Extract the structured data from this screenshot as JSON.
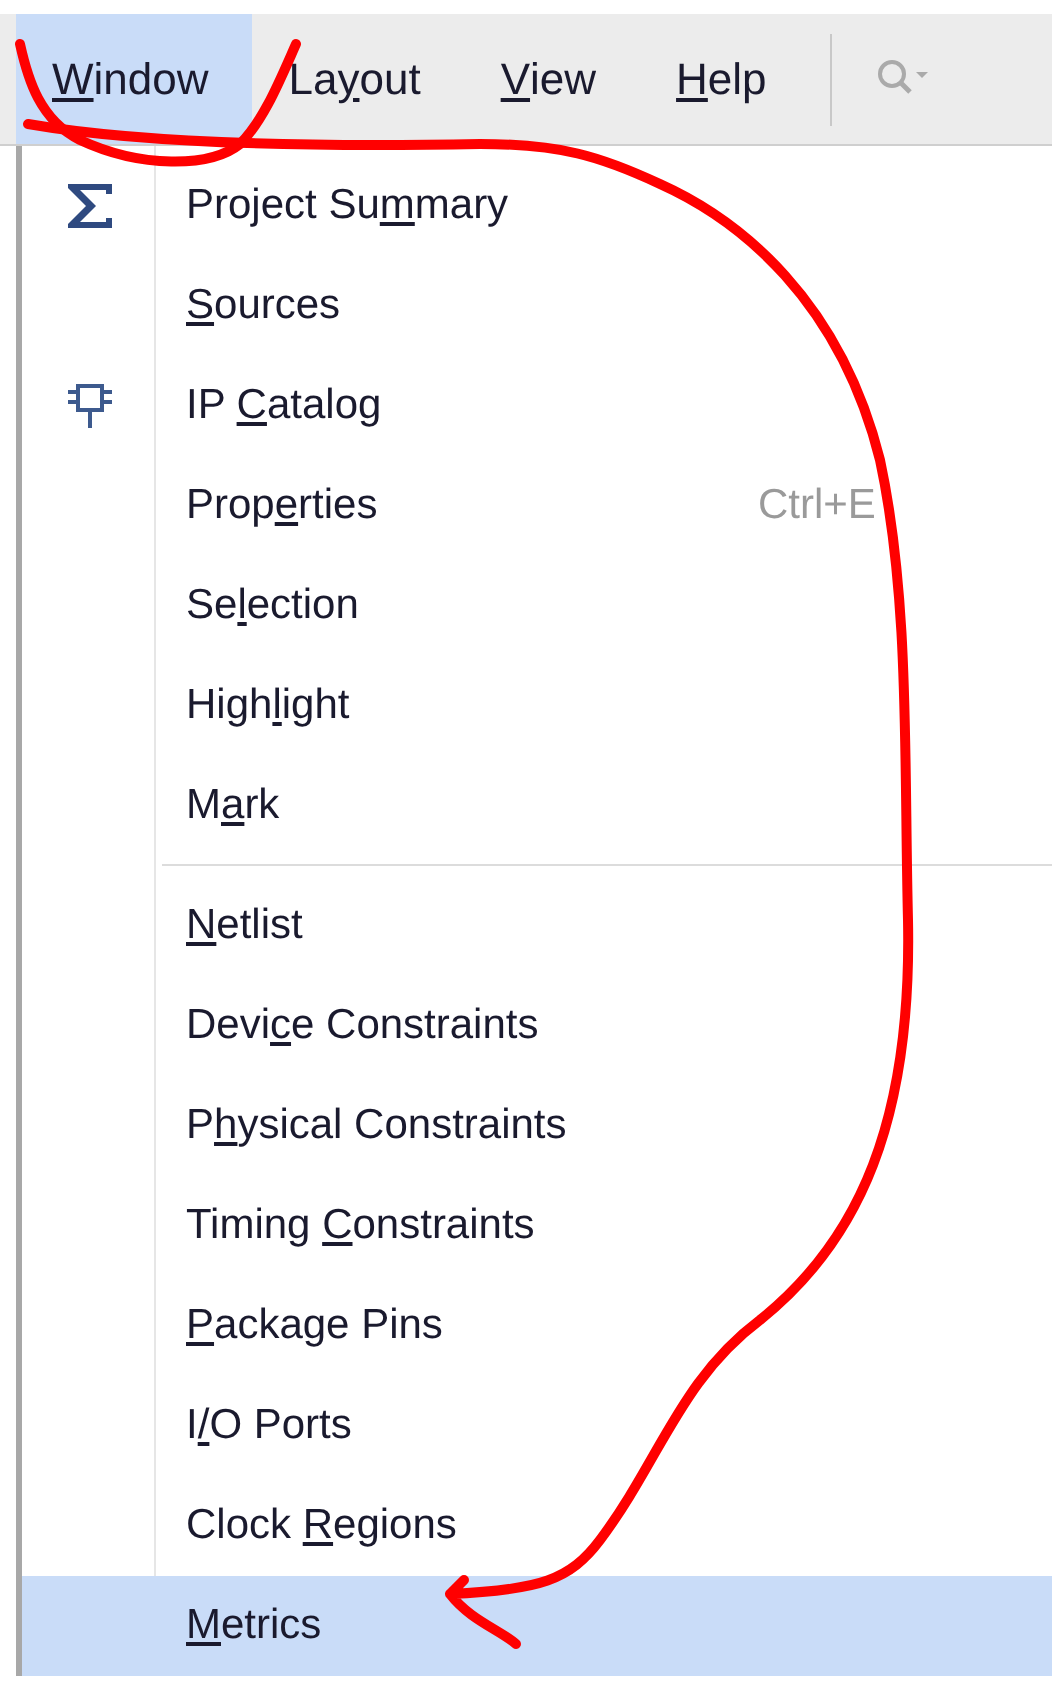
{
  "menubar": [
    {
      "mnemonic": "W",
      "rest": "indow",
      "selected": true
    },
    {
      "lead": "La",
      "mnemonic": "y",
      "rest": "out",
      "selected": false
    },
    {
      "mnemonic": "V",
      "rest": "iew",
      "selected": false
    },
    {
      "mnemonic": "H",
      "rest": "elp",
      "selected": false
    }
  ],
  "menu": {
    "groups": [
      [
        {
          "kind": "sum",
          "lead": "Project Su",
          "mnemonic": "m",
          "rest": "mary",
          "selected": false
        },
        {
          "mnemonic": "S",
          "rest": "ources",
          "selected": false
        },
        {
          "kind": "chip",
          "lead": "IP ",
          "mnemonic": "C",
          "rest": "atalog",
          "selected": false
        },
        {
          "lead": "Prop",
          "mnemonic": "e",
          "rest": "rties",
          "shortcut": "Ctrl+E",
          "selected": false
        },
        {
          "lead": "Se",
          "mnemonic": "l",
          "rest": "ection",
          "selected": false
        },
        {
          "lead": "High",
          "mnemonic": "l",
          "rest": "ight",
          "selected": false
        },
        {
          "lead": "M",
          "mnemonic": "a",
          "rest": "rk",
          "selected": false
        }
      ],
      [
        {
          "mnemonic": "N",
          "rest": "etlist",
          "selected": false
        },
        {
          "lead": "Devi",
          "mnemonic": "c",
          "rest": "e Constraints",
          "selected": false
        },
        {
          "lead": "P",
          "mnemonic": "h",
          "rest": "ysical Constraints",
          "selected": false
        },
        {
          "lead": "Timing ",
          "mnemonic": "C",
          "rest": "onstraints",
          "selected": false
        },
        {
          "mnemonic": "P",
          "rest": "ackage Pins",
          "selected": false
        },
        {
          "lead": "I",
          "mnemonic": "/",
          "rest": "O Ports",
          "selected": false
        },
        {
          "lead": "Clock ",
          "mnemonic": "R",
          "rest": "egions",
          "selected": false
        },
        {
          "mnemonic": "M",
          "rest": "etrics",
          "selected": true
        }
      ]
    ]
  }
}
